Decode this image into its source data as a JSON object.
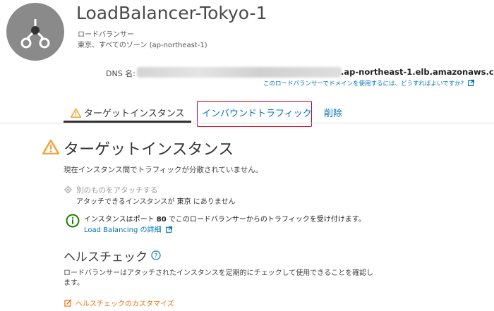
{
  "header": {
    "title": "LoadBalancer-Tokyo-1",
    "subtitle": "ロードバランサー",
    "region": "東京、すべてのゾーン (ap-northeast-1)"
  },
  "dns": {
    "label": "DNS 名:",
    "suffix": ".ap-northeast-1.elb.amazonaws.com",
    "help_link": "このロードバランサーでドメインを使用するには、どうすればよいですか?"
  },
  "tabs": [
    {
      "label": "ターゲットインスタンス"
    },
    {
      "label": "インバウンドトラフィック"
    },
    {
      "label": "削除"
    }
  ],
  "section": {
    "title": "ターゲットインスタンス",
    "description": "現在インスタンス間でトラフィックが分散されていません。",
    "attach_label": "別のものをアタッチする",
    "attach_sub_pre": "アタッチできるインスタンスが",
    "attach_sub_region": "東京",
    "attach_sub_post": "にありません",
    "info_pre": "インスタンスはポート",
    "info_port": "80",
    "info_post": "でこのロードバランサーからのトラフィックを受け付けます。",
    "info_link": "Load Balancing の詳細"
  },
  "health": {
    "title": "ヘルスチェック",
    "description": "ロードバランサーはアタッチされたインスタンスを定期的にチェックして使用できることを確認します。",
    "customize_link": "ヘルスチェックのカスタマイズ"
  },
  "colors": {
    "link": "#0073bb",
    "warning": "#f2a33a",
    "info_green": "#1d8102",
    "orange_link": "#ec7211",
    "highlight_box": "#d0021b"
  }
}
